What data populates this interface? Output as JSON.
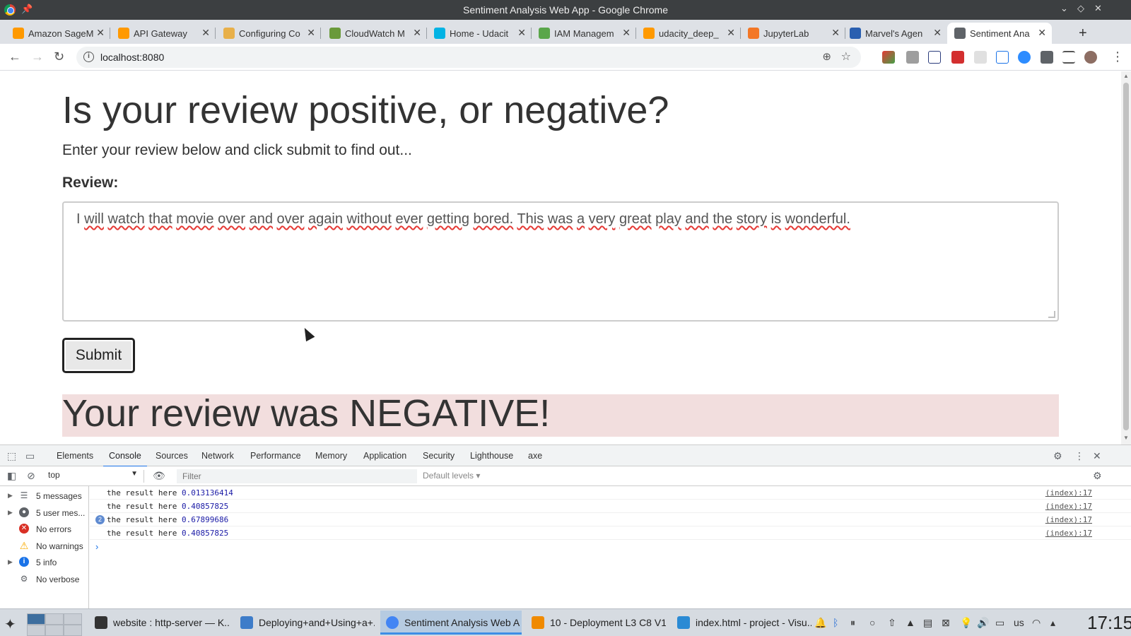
{
  "window": {
    "title": "Sentiment Analysis Web App - Google Chrome"
  },
  "tabs": [
    {
      "label": "Amazon SageM",
      "icon": "aws-icon",
      "color": "#ff9900"
    },
    {
      "label": "API Gateway",
      "icon": "aws-icon",
      "color": "#ff9900"
    },
    {
      "label": "Configuring Co",
      "icon": "box-icon",
      "color": "#e8b04a"
    },
    {
      "label": "CloudWatch M",
      "icon": "cloudwatch-icon",
      "color": "#6a9a3a"
    },
    {
      "label": "Home - Udacit",
      "icon": "udacity-icon",
      "color": "#02b3e4"
    },
    {
      "label": "IAM Managem",
      "icon": "iam-icon",
      "color": "#5aa64a"
    },
    {
      "label": "udacity_deep_",
      "icon": "aws-icon",
      "color": "#ff9900"
    },
    {
      "label": "JupyterLab",
      "icon": "jupyter-icon",
      "color": "#f37726"
    },
    {
      "label": "Marvel's Agen",
      "icon": "marvel-icon",
      "color": "#2a5fb0"
    },
    {
      "label": "Sentiment Ana",
      "icon": "globe-icon",
      "color": "#5f6368"
    }
  ],
  "toolbar": {
    "url": "localhost:8080"
  },
  "page": {
    "title": "Is your review positive, or negative?",
    "subtitle": "Enter your review below and click submit to find out...",
    "review_label": "Review:",
    "review_words": [
      "I",
      "will",
      "watch",
      "that",
      "movie",
      "over",
      "and",
      "over",
      "again",
      "without",
      "ever",
      "getting",
      "bored.",
      "This",
      "was",
      "a",
      "very",
      "great",
      "play",
      "and",
      "the",
      "story",
      "is",
      "wonderful."
    ],
    "submit_label": "Submit",
    "result": "Your review was NEGATIVE!"
  },
  "devtools": {
    "tabs": [
      "Elements",
      "Console",
      "Sources",
      "Network",
      "Performance",
      "Memory",
      "Application",
      "Security",
      "Lighthouse",
      "axe"
    ],
    "context": "top",
    "filter_placeholder": "Filter",
    "levels": "Default levels",
    "sidebar": [
      {
        "label": "5 messages",
        "icon": "list-icon",
        "color": "#5f6368"
      },
      {
        "label": "5 user mes...",
        "icon": "user-icon",
        "color": "#5f6368"
      },
      {
        "label": "No errors",
        "icon": "error-icon",
        "color": "#d93025"
      },
      {
        "label": "No warnings",
        "icon": "warning-icon",
        "color": "#f9ab00"
      },
      {
        "label": "5 info",
        "icon": "info-icon",
        "color": "#1a73e8"
      },
      {
        "label": "No verbose",
        "icon": "bug-icon",
        "color": "#5f6368"
      }
    ],
    "logs": [
      {
        "text": "the result here ",
        "value": "0.013136414",
        "source": "(index):17",
        "count": ""
      },
      {
        "text": "the result here ",
        "value": "0.40857825",
        "source": "(index):17",
        "count": ""
      },
      {
        "text": "the result here ",
        "value": "0.67899686",
        "source": "(index):17",
        "count": "2"
      },
      {
        "text": "the result here ",
        "value": "0.40857825",
        "source": "(index):17",
        "count": ""
      }
    ]
  },
  "taskbar": {
    "tasks": [
      {
        "label": "website : http-server — K...",
        "icon": "terminal-icon",
        "color": "#333"
      },
      {
        "label": "Deploying+and+Using+a+...",
        "icon": "folder-icon",
        "color": "#3d7cc9"
      },
      {
        "label": "Sentiment Analysis Web A...",
        "icon": "chrome-icon",
        "color": "#4285f4"
      },
      {
        "label": "10 - Deployment L3 C8 V1....",
        "icon": "vlc-icon",
        "color": "#f08a00"
      },
      {
        "label": "index.html - project - Visu...",
        "icon": "vscode-icon",
        "color": "#2a8ad4"
      }
    ],
    "keyboard_layout": "us",
    "clock": "17:15"
  }
}
